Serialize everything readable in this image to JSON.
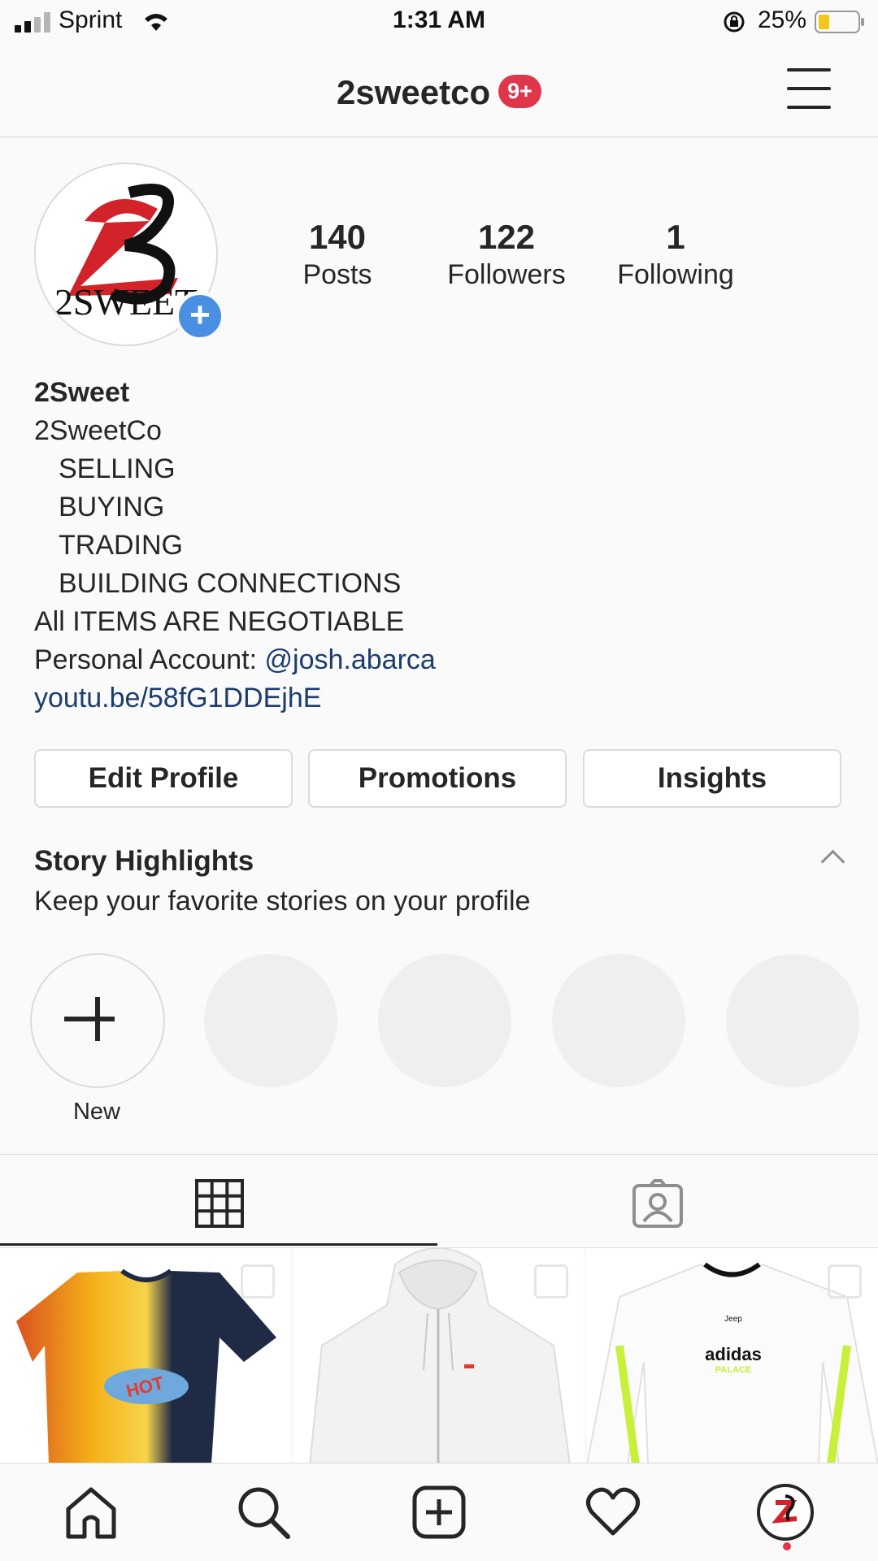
{
  "status_bar": {
    "carrier": "Sprint",
    "time": "1:31 AM",
    "battery": "25%"
  },
  "header": {
    "username": "2sweetco",
    "notification_badge": "9+"
  },
  "profile": {
    "avatar_text": "2SWEET",
    "stats": [
      {
        "value": "140",
        "label": "Posts"
      },
      {
        "value": "122",
        "label": "Followers"
      },
      {
        "value": "1",
        "label": "Following"
      }
    ]
  },
  "bio": {
    "name": "2Sweet",
    "line1": "2SweetCo",
    "line2": "SELLING",
    "line3": "BUYING",
    "line4": "TRADING",
    "line5": "BUILDING CONNECTIONS",
    "line6": "All ITEMS ARE NEGOTIABLE",
    "personal_prefix": "Personal Account: ",
    "personal_handle": "@josh.abarca",
    "website": "youtu.be/58fG1DDEjhE"
  },
  "buttons": {
    "edit_profile": "Edit Profile",
    "promotions": "Promotions",
    "insights": "Insights"
  },
  "highlights": {
    "title": "Story Highlights",
    "subtitle": "Keep your favorite stories on your profile",
    "new_label": "New"
  },
  "posts": {
    "post2_logo": "adidas",
    "post2_sub": "PALACE",
    "post2_sponsor": "Jeep"
  }
}
